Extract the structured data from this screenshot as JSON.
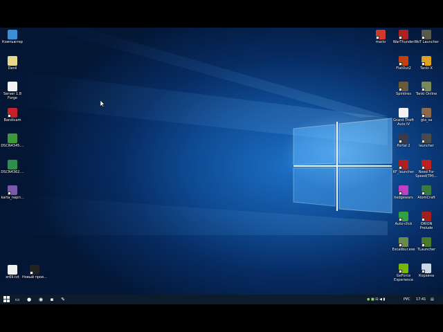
{
  "desktop_icons_left": [
    {
      "label": "Компьютер",
      "icon": "computer-icon",
      "color": "#3a8fd8"
    },
    {
      "label": "Danil",
      "icon": "user-folder-icon",
      "color": "#e9d98a"
    },
    {
      "label": "Server 1.8 Forge",
      "icon": "file-icon",
      "color": "#f2f2f2"
    },
    {
      "label": "Bandicam",
      "icon": "bandicam-icon",
      "color": "#c8202a"
    },
    {
      "label": "DSCN4345....",
      "icon": "image-file-icon",
      "color": "#3c9a3a"
    },
    {
      "label": "DSCN4362....",
      "icon": "image-file-icon",
      "color": "#2f8f4a"
    },
    {
      "label": "karta_nepri...",
      "icon": "map-image-icon",
      "color": "#7a5aa8"
    }
  ],
  "desktop_icons_bottom_left": [
    {
      "label": "xr69.txt",
      "icon": "text-file-icon",
      "color": "#f0f0f0"
    },
    {
      "label": "Новый прое...",
      "icon": "project-icon",
      "color": "#222222"
    }
  ],
  "desktop_icons_right": [
    [
      {
        "label": "mario",
        "icon": "mario-icon",
        "color": "#d13a2a"
      },
      {
        "label": "WarThunder",
        "icon": "warthunder-icon",
        "color": "#b02020"
      },
      {
        "label": "WoT Launcher",
        "icon": "wot-icon",
        "color": "#5a5a4a"
      }
    ],
    [
      {
        "label": "FlatOut2",
        "icon": "flatout-icon",
        "color": "#c04010"
      },
      {
        "label": "Tanki X",
        "icon": "tanki-x-icon",
        "color": "#e0a020"
      }
    ],
    [
      {
        "label": "Spintires",
        "icon": "spintires-icon",
        "color": "#6a5a3a"
      },
      {
        "label": "Tanki Online",
        "icon": "tanki-online-icon",
        "color": "#7a8a5a"
      }
    ],
    [
      {
        "label": "Grand Theft Auto IV",
        "icon": "gta-file-icon",
        "color": "#f2f2f2"
      },
      {
        "label": "gta_sa",
        "icon": "gta-sa-icon",
        "color": "#8a6a4a"
      }
    ],
    [
      {
        "label": "Portal 2",
        "icon": "portal-icon",
        "color": "#3a3a4a"
      },
      {
        "label": "launcher",
        "icon": "launcher-icon",
        "color": "#4a4a4a"
      }
    ],
    [
      {
        "label": "KF_launcher",
        "icon": "kf-launcher-icon",
        "color": "#b02020"
      },
      {
        "label": "Need For Speed(TM)...",
        "icon": "nfs-icon",
        "color": "#c02020"
      }
    ],
    [
      {
        "label": "hedgewars",
        "icon": "hedgewars-icon",
        "color": "#c040c0"
      },
      {
        "label": "AtomCraft",
        "icon": "atomcraft-icon",
        "color": "#3a7a3a"
      }
    ],
    [
      {
        "label": "Auto-click",
        "icon": "cursor-icon",
        "color": "#30a040"
      },
      {
        "label": "ORION Prelude",
        "icon": "orion-icon",
        "color": "#a02020"
      }
    ],
    [
      {
        "label": "Excalibur.exe",
        "icon": "excalibur-icon",
        "color": "#6a8a4a"
      },
      {
        "label": "TLauncher",
        "icon": "tlauncher-icon",
        "color": "#4a7a2a"
      }
    ],
    [
      {
        "label": "GeForce Experience",
        "icon": "geforce-icon",
        "color": "#76b900"
      },
      {
        "label": "Корзина",
        "icon": "recycle-bin-icon",
        "color": "#c8d8e8"
      }
    ]
  ],
  "taskbar": {
    "start_icon": "windows-start-icon",
    "pinned": [
      {
        "name": "task-view-icon",
        "glyph": "▭"
      },
      {
        "name": "obs-icon",
        "glyph": "●"
      },
      {
        "name": "chrome-icon",
        "glyph": "◉"
      },
      {
        "name": "app-icon",
        "glyph": "▪"
      },
      {
        "name": "pen-icon",
        "glyph": "✎"
      }
    ],
    "tray": {
      "language": "РУС",
      "time": "17:41"
    }
  },
  "colors": {
    "accent": "#1d6fc4",
    "taskbar_bg": "#0d1c2d"
  }
}
